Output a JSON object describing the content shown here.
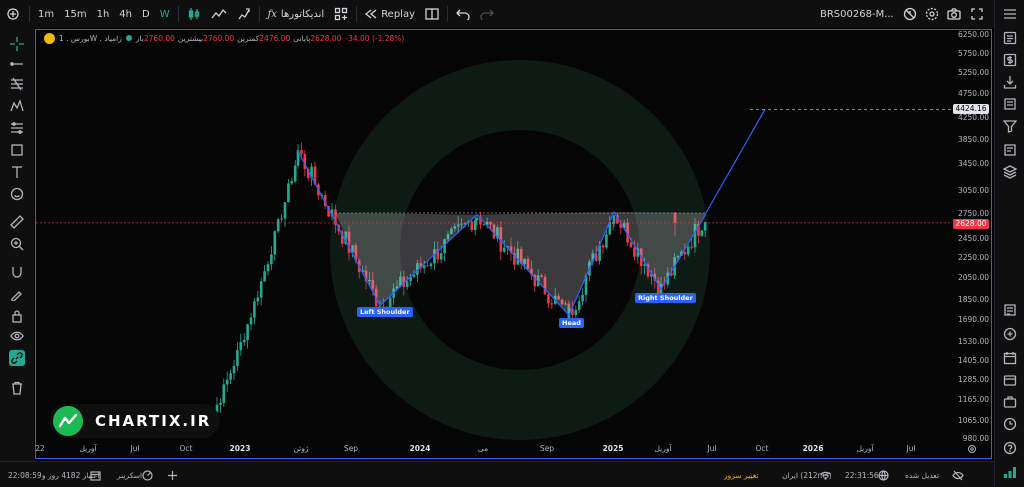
{
  "toolbar": {
    "intervals": [
      "1m",
      "15m",
      "1h",
      "4h",
      "D",
      "W"
    ],
    "active_interval": "W",
    "indicators_label": "اندیکاتورها",
    "replay_label": "Replay",
    "symbol": "BRS00268-M..."
  },
  "legend": {
    "exchange": "بورس . 1W . زامیاد",
    "open_label": "باز",
    "open_value": "2760.00",
    "high_label": "بیشترین",
    "high_value": "2760.00",
    "low_label": "کمترین",
    "low_value": "2476.00",
    "close_label": "پایانی",
    "close_value": "2628.00",
    "change": "-34.00 (-1.28%)"
  },
  "price_axis": {
    "ticks": [
      "6250.00",
      "5750.00",
      "5250.00",
      "4750.00",
      "4250.00",
      "3850.00",
      "3450.00",
      "3050.00",
      "2750.00",
      "2450.00",
      "2250.00",
      "2050.00",
      "1850.00",
      "1690.00",
      "1530.00",
      "1405.00",
      "1285.00",
      "1165.00",
      "1065.00",
      "980.00"
    ],
    "target_badge": "4424.16",
    "current_badge": "2628.00"
  },
  "time_axis": {
    "labels": [
      "22",
      "آوریل",
      "Jul",
      "Oct",
      "2023",
      "ژوئن",
      "Sep",
      "2024",
      "می",
      "Sep",
      "2025",
      "آوریل",
      "Jul",
      "Oct",
      "2026",
      "آوریل",
      "Jul"
    ]
  },
  "pattern_labels": {
    "left_shoulder": "Left Shoulder",
    "head": "Head",
    "right_shoulder": "Right Shoulder"
  },
  "watermark_text": "CHARTIX.IR",
  "bottom": {
    "datetime": "22:08:59",
    "credit": "اعتبار 4182 روز و",
    "screener": "اسکرینر",
    "server_change": "تغییر سرور",
    "server_info": "ایران (212ms)",
    "clock": "22:31:56",
    "adjusted": "تعدیل شده"
  },
  "colors": {
    "up": "#22ab94",
    "down": "#f23645",
    "pattern": "#2962ff",
    "background": "#000000"
  },
  "chart_data": {
    "type": "candlestick",
    "interval": "1W",
    "pattern": "inverse head and shoulders",
    "price_scale": "log",
    "ylim": [
      980,
      6250
    ],
    "last": {
      "open": 2760.0,
      "high": 2760.0,
      "low": 2476.0,
      "close": 2628.0,
      "change": -34.0,
      "change_pct": -1.28
    },
    "pivots": [
      {
        "label": "",
        "price": 3650
      },
      {
        "label": "Left Shoulder",
        "price": 1800
      },
      {
        "label": "",
        "price": 2730
      },
      {
        "label": "Head",
        "price": 1720
      },
      {
        "label": "",
        "price": 2760
      },
      {
        "label": "Right Shoulder",
        "price": 1940
      },
      {
        "label": "",
        "price": 2740
      }
    ],
    "target_price": 4424.16,
    "neckline": 2750
  }
}
